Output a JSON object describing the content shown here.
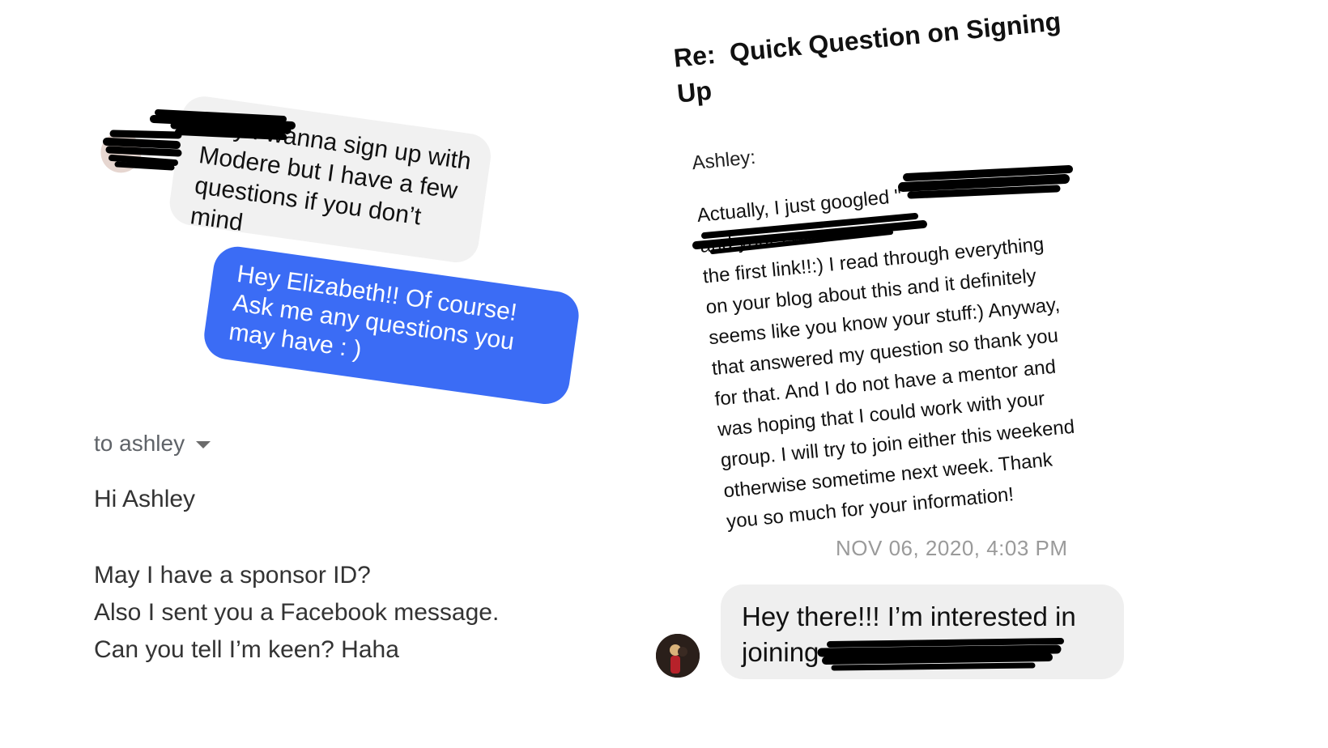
{
  "chat_top": {
    "incoming_message": "Hey I wanna sign up with Modere but I have a few questions if you don’t mind",
    "outgoing_message": "Hey Elizabeth!! Of course! Ask me any questions you may have : )"
  },
  "email": {
    "to_label": "to ashley",
    "greeting": "Hi Ashley",
    "lines": [
      "May I have a sponsor ID?",
      "Also I sent you a Facebook message.",
      "Can you tell I’m keen? Haha"
    ]
  },
  "message": {
    "subject_prefix": "Re:",
    "subject": "Quick Question on Signing Up",
    "sender": "Ashley:",
    "body": "Actually, I just googled \"                               \nand yours was\nthe first link!!:)  I read through everything\non your blog about this and it definitely\nseems like you know your stuff:)  Anyway,\nthat answered my question so thank you\nfor that.  And I do not have a mentor and\nwas hoping that I could work with your\ngroup.  I will try to join either this weekend\notherwise sometime next week.  Thank\nyou so much for your information!"
  },
  "chat_bottom": {
    "timestamp": "NOV 06, 2020, 4:03 PM",
    "message": "Hey there!!! I’m interested in joining"
  },
  "colors": {
    "outgoing_bubble": "#3b6cf5",
    "incoming_bubble": "#f1f1f1",
    "redaction": "#000000"
  }
}
